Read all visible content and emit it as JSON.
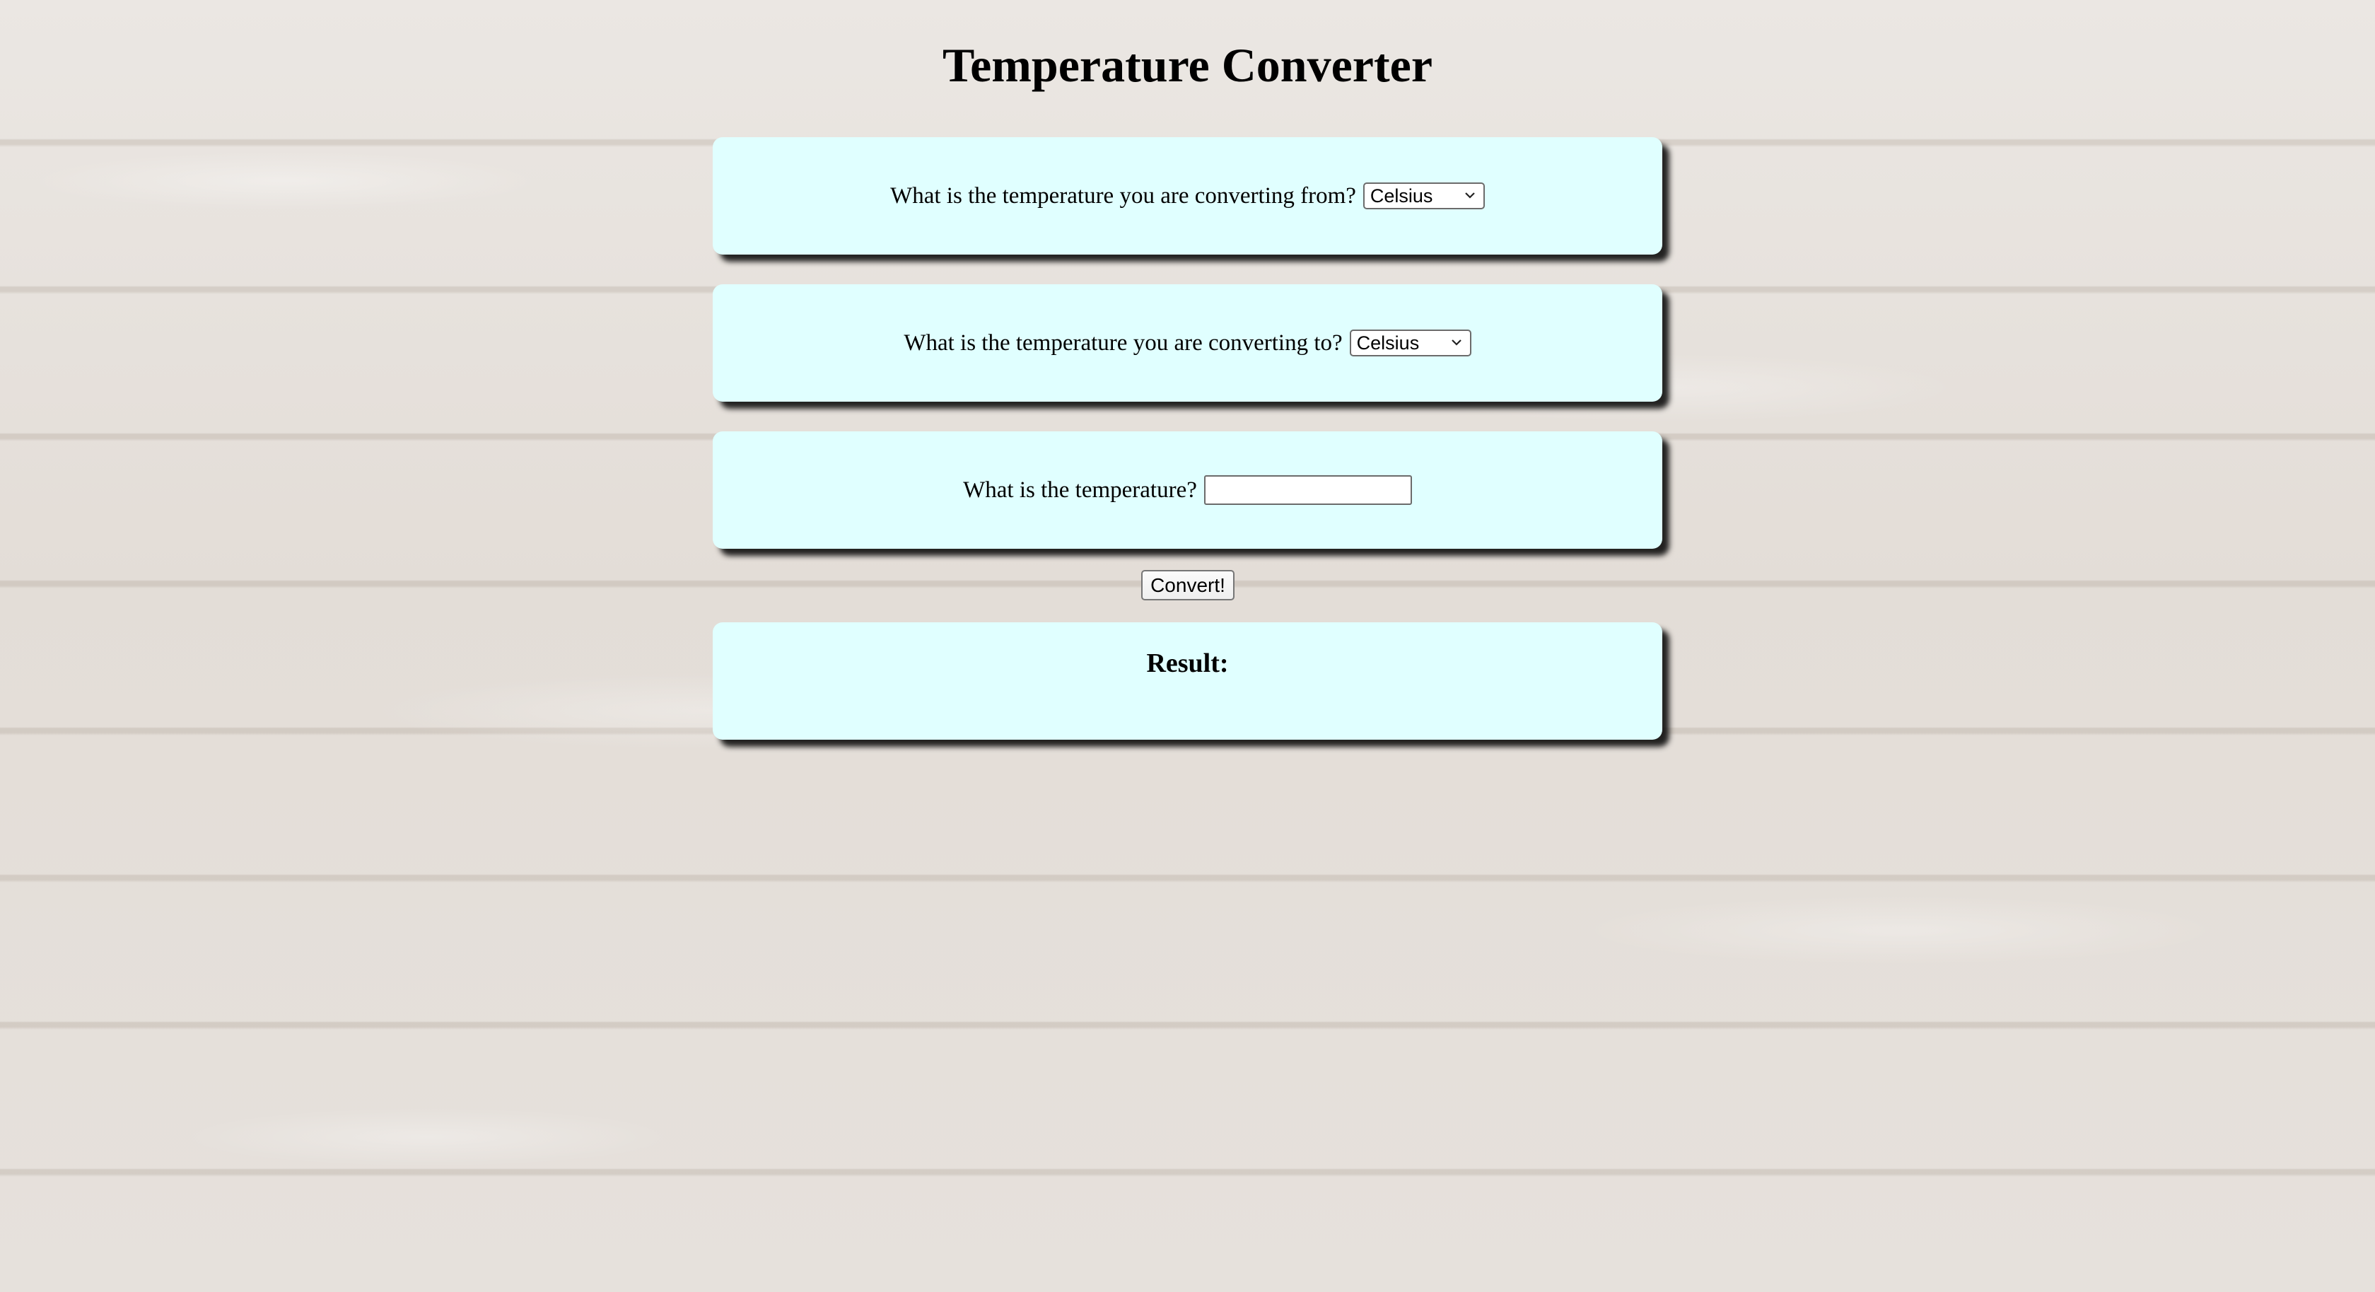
{
  "page": {
    "title": "Temperature Converter"
  },
  "form": {
    "from": {
      "label": "What is the temperature you are converting from?",
      "selected": "Celsius"
    },
    "to": {
      "label": "What is the temperature you are converting to?",
      "selected": "Celsius"
    },
    "temperature": {
      "label": "What is the temperature?",
      "value": ""
    },
    "convert_label": "Convert!"
  },
  "result": {
    "heading": "Result:"
  },
  "icons": {
    "dropdown": "chevron-down-icon"
  },
  "colors": {
    "card_background": "#e0ffff",
    "card_shadow": "#000000"
  }
}
